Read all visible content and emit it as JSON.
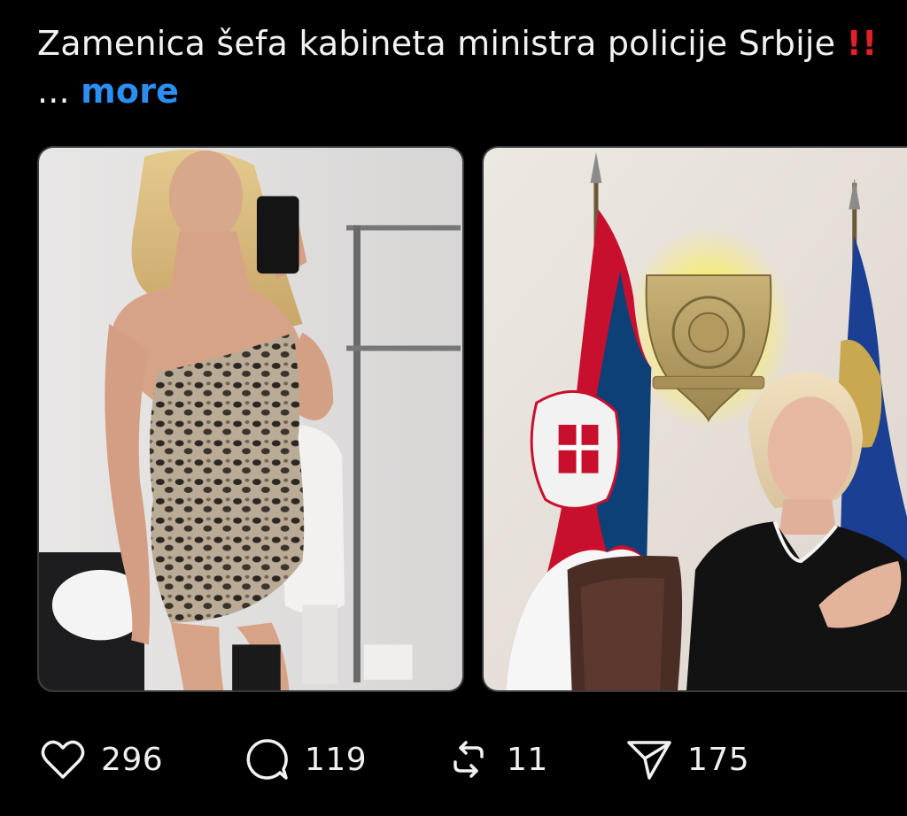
{
  "post": {
    "caption_text": "Zamenica šefa kabineta ministra policije Srbije",
    "caption_emoji": "‼️",
    "caption_ellipsis": "...",
    "caption_more": "more"
  },
  "media": [
    {
      "name": "selfie-photo",
      "description_icon": "image"
    },
    {
      "name": "office-photo",
      "description_icon": "image"
    }
  ],
  "actions": {
    "likes": {
      "icon": "heart-icon",
      "count": "296"
    },
    "replies": {
      "icon": "comment-icon",
      "count": "119"
    },
    "reposts": {
      "icon": "repost-icon",
      "count": "11"
    },
    "shares": {
      "icon": "send-icon",
      "count": "175"
    }
  }
}
